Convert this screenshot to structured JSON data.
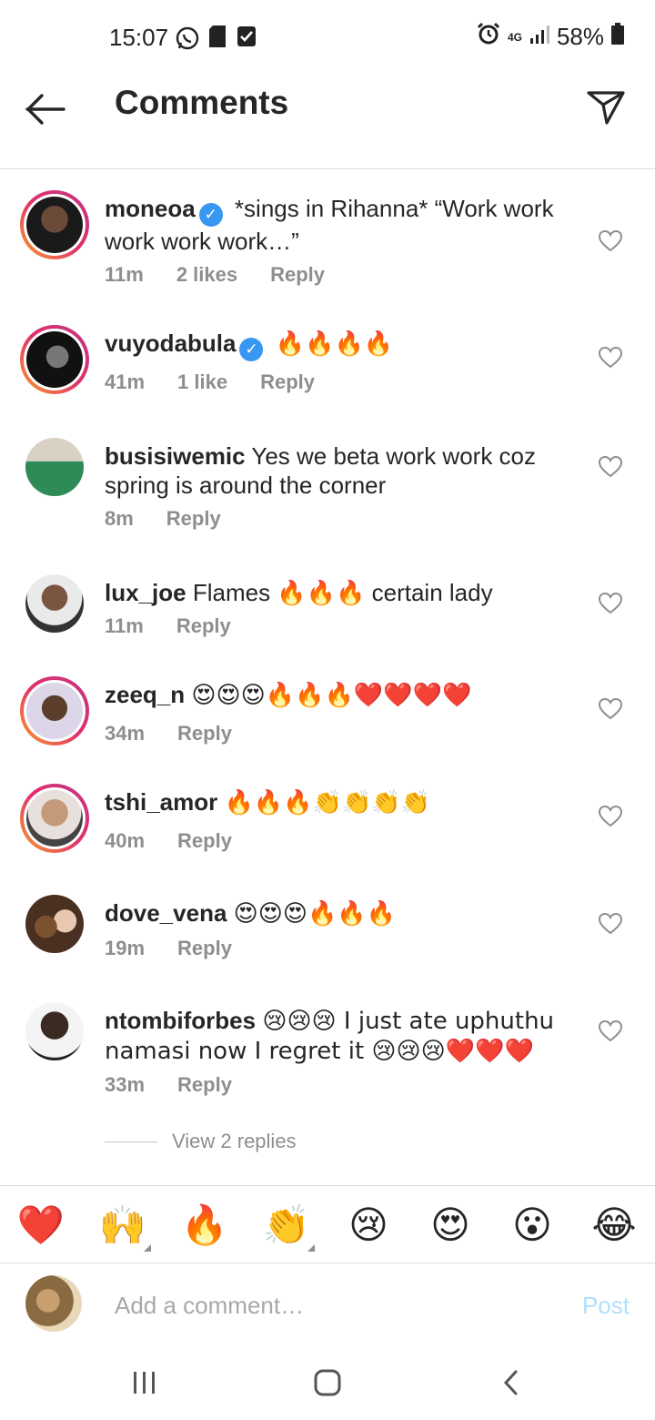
{
  "status_bar": {
    "time": "15:07",
    "battery": "58%",
    "network": "4G"
  },
  "header": {
    "title": "Comments"
  },
  "comments": [
    {
      "username": "moneoa",
      "verified": true,
      "text": "*sings in Rihanna* “Work work work work work…”",
      "time": "11m",
      "likes": "2 likes",
      "reply": "Reply",
      "story_ring": true,
      "avatar_color": "#1a1a1a"
    },
    {
      "username": "vuyodabula",
      "verified": true,
      "text": "🔥🔥🔥🔥",
      "time": "41m",
      "likes": "1 like",
      "reply": "Reply",
      "story_ring": true,
      "avatar_color": "#222222"
    },
    {
      "username": "busisiwemic",
      "verified": false,
      "text": "Yes we beta work work coz spring is around the corner",
      "time": "8m",
      "reply": "Reply",
      "story_ring": false,
      "avatar_color": "#2e8b57"
    },
    {
      "username": "lux_joe",
      "verified": false,
      "text": "Flames 🔥🔥🔥 certain lady",
      "time": "11m",
      "reply": "Reply",
      "story_ring": false,
      "avatar_color": "#6b4a3a"
    },
    {
      "username": "zeeq_n",
      "verified": false,
      "text": "😍😍😍🔥🔥🔥❤️❤️❤️❤️",
      "time": "34m",
      "reply": "Reply",
      "story_ring": true,
      "avatar_color": "#5a3e2b"
    },
    {
      "username": "tshi_amor",
      "verified": false,
      "text": "🔥🔥🔥👏👏👏👏",
      "time": "40m",
      "reply": "Reply",
      "story_ring": true,
      "avatar_color": "#8a6e5a"
    },
    {
      "username": "dove_vena",
      "verified": false,
      "text": "😍😍😍🔥🔥🔥",
      "time": "19m",
      "reply": "Reply",
      "story_ring": false,
      "avatar_color": "#7a5230"
    },
    {
      "username": "ntombiforbes",
      "verified": false,
      "text": "😢😢😢 I just ate uphuthu namasi now I regret it 😢😢😢❤️❤️❤️",
      "time": "33m",
      "reply": "Reply",
      "story_ring": false,
      "avatar_color": "#3a2a22"
    }
  ],
  "view_replies": "View 2 replies",
  "reactions": [
    "❤️",
    "🙌",
    "🔥",
    "👏",
    "😢",
    "😍",
    "😮",
    "😂"
  ],
  "add_comment": {
    "placeholder": "Add a comment…",
    "post_label": "Post"
  },
  "colors": {
    "accent": "#3897f0",
    "post_disabled": "#b2dffc",
    "meta": "#8e8e8e",
    "divider": "#dbdbdb"
  }
}
